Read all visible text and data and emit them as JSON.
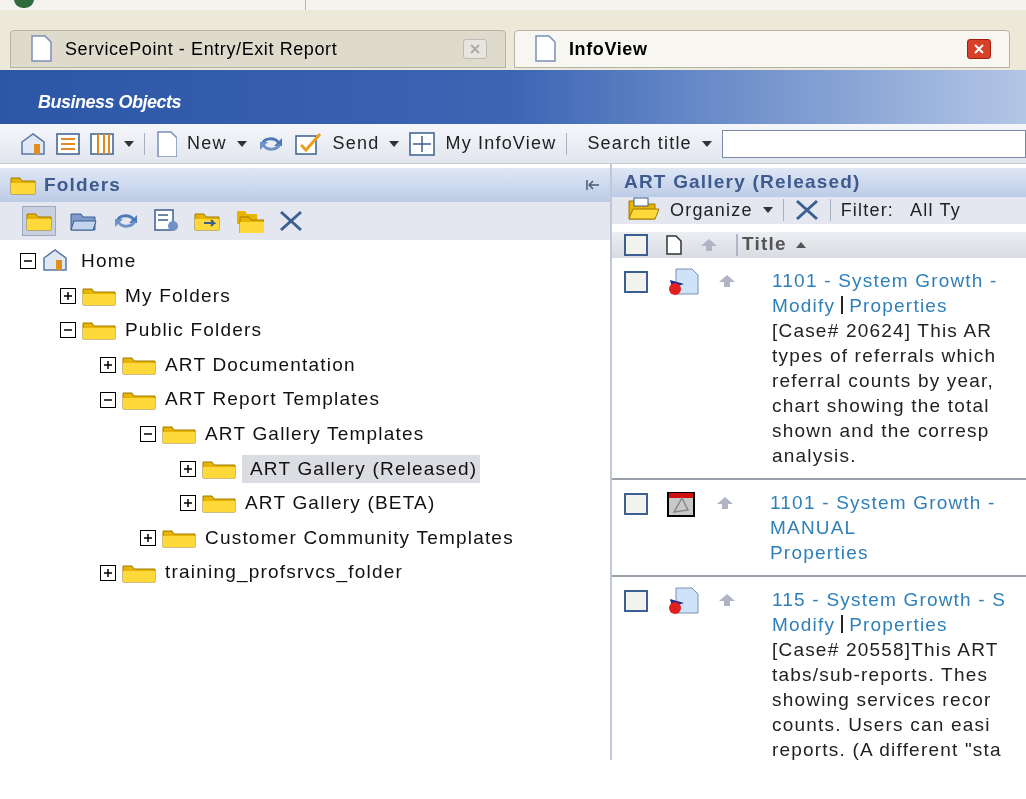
{
  "browser_tabs": [
    {
      "title": "ServicePoint - Entry/Exit Report",
      "selected": false
    },
    {
      "title": "InfoView",
      "selected": true
    }
  ],
  "banner": {
    "logo": "Business Objects"
  },
  "toolbar": {
    "new": "New",
    "send": "Send",
    "my_infoview": "My InfoView",
    "search_label": "Search title"
  },
  "folders_panel": {
    "title": "Folders",
    "tree": [
      {
        "label": "Home",
        "kind": "home",
        "expanded": true,
        "selected": false,
        "children": [
          {
            "label": "My Folders",
            "kind": "folder",
            "expanded": false,
            "selected": false
          },
          {
            "label": "Public Folders",
            "kind": "folder",
            "expanded": true,
            "selected": false,
            "children": [
              {
                "label": "ART Documentation",
                "kind": "folder",
                "expanded": false,
                "selected": false
              },
              {
                "label": "ART Report Templates",
                "kind": "folder",
                "expanded": true,
                "selected": false,
                "children": [
                  {
                    "label": "ART Gallery Templates",
                    "kind": "folder",
                    "expanded": true,
                    "selected": false,
                    "children": [
                      {
                        "label": "ART Gallery (Released)",
                        "kind": "folder",
                        "expanded": false,
                        "selected": true
                      },
                      {
                        "label": "ART Gallery (BETA)",
                        "kind": "folder",
                        "expanded": false,
                        "selected": false
                      }
                    ]
                  },
                  {
                    "label": "Customer Community Templates",
                    "kind": "folder",
                    "expanded": false,
                    "selected": false
                  }
                ]
              },
              {
                "label": "training_profsrvcs_folder",
                "kind": "folder",
                "expanded": false,
                "selected": false
              }
            ]
          }
        ]
      }
    ]
  },
  "content_panel": {
    "title": "ART Gallery (Released)",
    "organize": "Organize",
    "filter_label": "Filter:",
    "filter_value": "All Ty",
    "column_title": "Title",
    "select_all_checked": false,
    "documents": [
      {
        "kind": "report",
        "checked": false,
        "title_lines": [
          "1101 - System Growth -"
        ],
        "links": [
          "Modify",
          "Properties"
        ],
        "description_lines": [
          "[Case# 20624] This AR",
          "types of referrals which",
          "referral counts by year,",
          "chart showing the total",
          "shown and the corresp",
          "analysis."
        ]
      },
      {
        "kind": "pdf",
        "checked": false,
        "title_lines": [
          "1101 - System Growth -",
          "MANUAL"
        ],
        "links": [
          "Properties"
        ]
      },
      {
        "kind": "report",
        "checked": false,
        "title_lines": [
          "115 - System Growth - S"
        ],
        "links": [
          "Modify",
          "Properties"
        ],
        "description_lines": [
          "[Case# 20558]This ART",
          "tabs/sub-reports. Thes",
          "showing services recor",
          "counts. Users can easi",
          "reports. (A different \"sta"
        ]
      }
    ]
  }
}
